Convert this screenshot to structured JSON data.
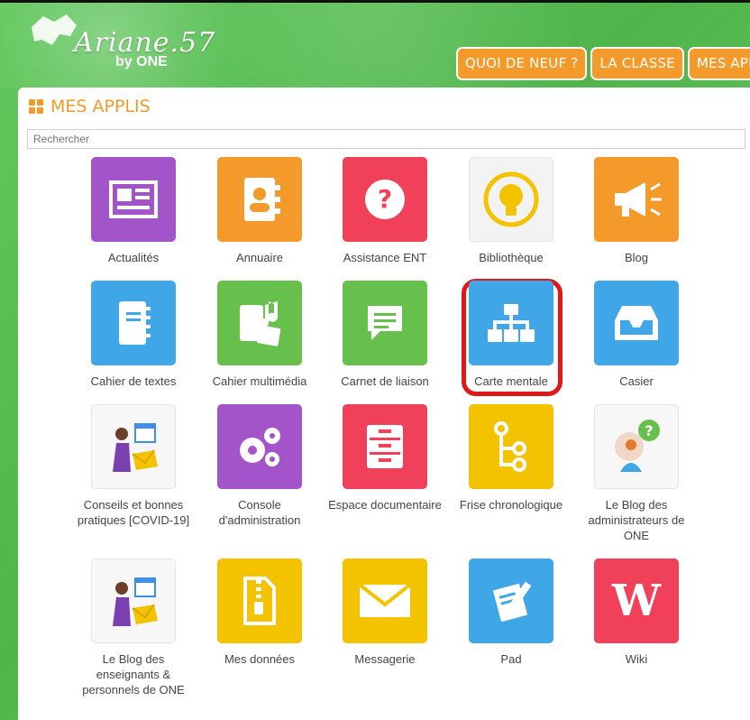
{
  "header": {
    "logo_text": "Ariane.57",
    "logo_sub": "by ONE",
    "nav": [
      "QUOI DE NEUF ?",
      "LA CLASSE",
      "MES APPLIS"
    ]
  },
  "page": {
    "title": "MES APPLIS",
    "search_placeholder": "Rechercher"
  },
  "apps": [
    {
      "label": "Actualités",
      "color": "#a254c8",
      "icon": "newspaper-icon"
    },
    {
      "label": "Annuaire",
      "color": "#f39a2b",
      "icon": "contact-book-icon"
    },
    {
      "label": "Assistance ENT",
      "color": "#f0405a",
      "icon": "question-icon"
    },
    {
      "label": "Bibliothèque",
      "color": "#f3f3f3",
      "icon": "lightbulb-icon"
    },
    {
      "label": "Blog",
      "color": "#f39a2b",
      "icon": "megaphone-icon"
    },
    {
      "label": "Cahier de textes",
      "color": "#3fa7e8",
      "icon": "notebook-icon"
    },
    {
      "label": "Cahier multimédia",
      "color": "#67c04b",
      "icon": "multimedia-notebook-icon"
    },
    {
      "label": "Carnet de liaison",
      "color": "#67c04b",
      "icon": "chat-bubble-icon"
    },
    {
      "label": "Carte mentale",
      "color": "#3fa7e8",
      "icon": "sitemap-icon"
    },
    {
      "label": "Casier",
      "color": "#3fa7e8",
      "icon": "inbox-tray-icon"
    },
    {
      "label": "Conseils et bonnes pratiques [COVID-19]",
      "color": "#f7f7f7",
      "icon": "calendar-person-icon"
    },
    {
      "label": "Console d'administration",
      "color": "#a254c8",
      "icon": "gears-icon"
    },
    {
      "label": "Espace documentaire",
      "color": "#f0405a",
      "icon": "drawers-icon"
    },
    {
      "label": "Frise chronologique",
      "color": "#f3c300",
      "icon": "timeline-icon"
    },
    {
      "label": "Le Blog des administrateurs de ONE",
      "color": "#f7f7f7",
      "icon": "person-question-icon"
    },
    {
      "label": "Le Blog des enseignants & personnels de ONE",
      "color": "#f7f7f7",
      "icon": "calendar-person-icon"
    },
    {
      "label": "Mes données",
      "color": "#f3c300",
      "icon": "zip-file-icon"
    },
    {
      "label": "Messagerie",
      "color": "#f3c300",
      "icon": "envelope-icon"
    },
    {
      "label": "Pad",
      "color": "#3fa7e8",
      "icon": "pad-icon"
    },
    {
      "label": "Wiki",
      "color": "#f0405a",
      "icon": "wiki-icon"
    }
  ]
}
